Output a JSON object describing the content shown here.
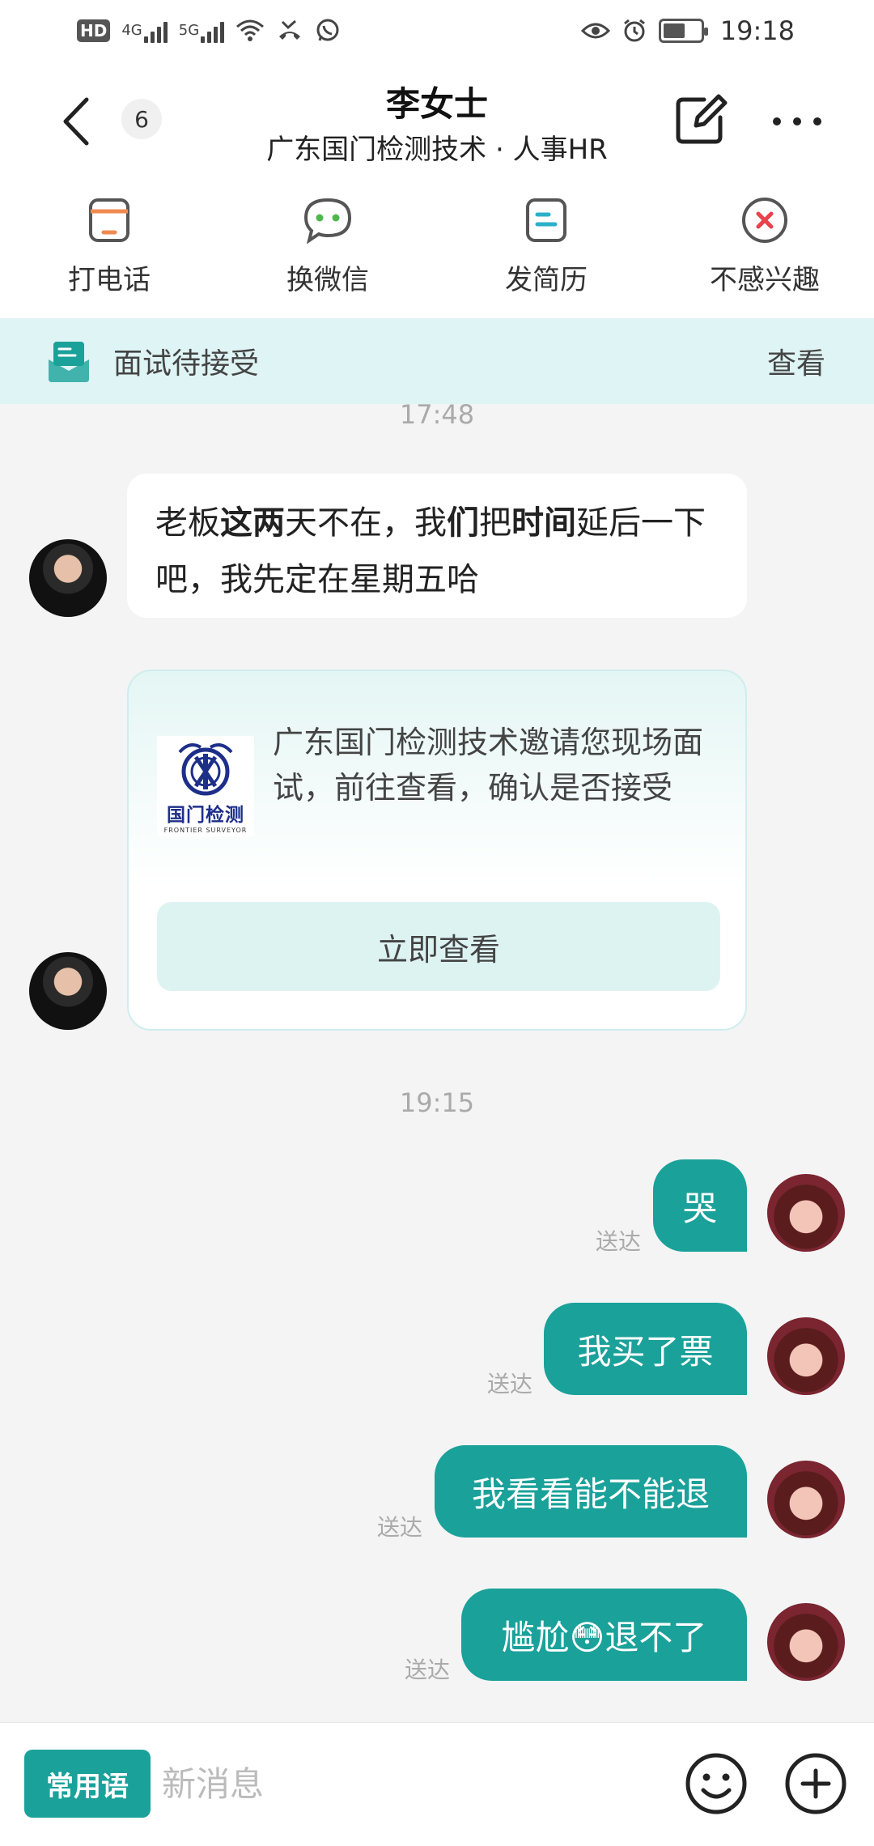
{
  "status_bar": {
    "hd_label": "HD",
    "sim1": "4G",
    "sim2": "5G",
    "time": "19:18",
    "battery_level": 0.6
  },
  "header": {
    "unread_count": "6",
    "contact_name": "李女士",
    "contact_company": "广东国门检测技术 · 人事HR"
  },
  "actions": [
    {
      "label": "打电话",
      "icon": "phone-icon"
    },
    {
      "label": "换微信",
      "icon": "wechat-icon"
    },
    {
      "label": "发简历",
      "icon": "resume-icon"
    },
    {
      "label": "不感兴趣",
      "icon": "not-interested-icon"
    }
  ],
  "banner": {
    "text": "面试待接受",
    "link": "查看"
  },
  "messages": {
    "time1": "17:48",
    "incoming1_parts": [
      "老板",
      "这两",
      "天不在，我",
      "们",
      "把",
      "时间",
      "延后一下吧，我先定在星期五哈"
    ],
    "card": {
      "logo_text": "国门检测",
      "logo_sub": "FRONTIER SURVEYOR",
      "text": "广东国门检测技术邀请您现场面试，前往查看，确认是否接受",
      "button": "立即查看"
    },
    "time2": "19:15",
    "outgoing": [
      {
        "text": "哭",
        "status": "送达"
      },
      {
        "text": "我买了票",
        "status": "送达"
      },
      {
        "text": "我看看能不能退",
        "status": "送达"
      },
      {
        "text": "尴尬😳退不了",
        "status": "送达"
      }
    ]
  },
  "input_bar": {
    "phrases_label": "常用语",
    "placeholder": "新消息"
  },
  "colors": {
    "accent": "#1aa19a",
    "banner_bg": "#dff4f4",
    "chat_bg": "#f4f4f4"
  }
}
